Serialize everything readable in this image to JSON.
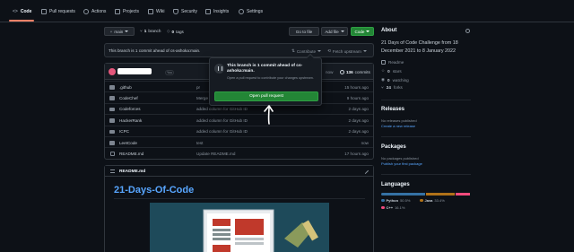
{
  "tabs": [
    {
      "label": "Code",
      "icon": "code-icon",
      "active": true
    },
    {
      "label": "Pull requests",
      "icon": "pull-request-icon"
    },
    {
      "label": "Actions",
      "icon": "play-icon"
    },
    {
      "label": "Projects",
      "icon": "table-icon"
    },
    {
      "label": "Wiki",
      "icon": "book-icon"
    },
    {
      "label": "Security",
      "icon": "shield-icon"
    },
    {
      "label": "Insights",
      "icon": "graph-icon"
    },
    {
      "label": "Settings",
      "icon": "gear-icon"
    }
  ],
  "controls": {
    "branch": "main",
    "branch_count": "1",
    "branch_label": "branch",
    "tag_count": "0",
    "tag_label": "tags",
    "go_to_file": "Go to file",
    "add_file": "Add file",
    "code": "Code"
  },
  "ahead_bar": {
    "text": "This branch is 1 commit ahead of cs-ashoka:main.",
    "contribute": "Contribute",
    "fetch": "Fetch upstream"
  },
  "commit": {
    "you_badge": "You",
    "time": "now",
    "count": "136",
    "count_label": "commits"
  },
  "files": [
    {
      "name": ".github",
      "type": "dir",
      "message": "pr",
      "age": "15 hours ago"
    },
    {
      "name": "CodeChef",
      "type": "dir",
      "message": "Merge",
      "age": "9 hours ago"
    },
    {
      "name": "Codeforces",
      "type": "dir",
      "message": "added column for GitHub ID",
      "age": "2 days ago"
    },
    {
      "name": "HackerRank",
      "type": "dir",
      "message": "added column for GitHub ID",
      "age": "2 days ago"
    },
    {
      "name": "ICPC",
      "type": "dir",
      "message": "added column for GitHub ID",
      "age": "2 days ago"
    },
    {
      "name": "LeetCode",
      "type": "dir",
      "message": "test",
      "age": "now"
    },
    {
      "name": "README.md",
      "type": "file",
      "message": "Update README.md",
      "age": "17 hours ago"
    }
  ],
  "readme": {
    "label": "README.md",
    "title": "21-Days-Of-Code"
  },
  "popup": {
    "title": "This branch is 1 commit ahead of cs-ashoka:main.",
    "subtitle": "Open a pull request to contribute your changes upstream.",
    "button": "Open pull request"
  },
  "about": {
    "heading": "About",
    "description": "21 Days of Code Challenge from 18 December 2021 to 8 January 2022",
    "readme_link": "Readme",
    "stars_count": "0",
    "stars_label": "stars",
    "watching_count": "0",
    "watching_label": "watching",
    "forks_count": "24",
    "forks_label": "forks"
  },
  "releases": {
    "heading": "Releases",
    "empty": "No releases published",
    "link": "Create a new release"
  },
  "packages": {
    "heading": "Packages",
    "empty": "No packages published",
    "link": "Publish your first package"
  },
  "languages": {
    "heading": "Languages",
    "items": [
      {
        "name": "Python",
        "percent": "50.5%",
        "color": "#3572A5",
        "value": 50.5
      },
      {
        "name": "Java",
        "percent": "33.4%",
        "color": "#b07219",
        "value": 33.4
      },
      {
        "name": "C++",
        "percent": "16.1%",
        "color": "#f34b7d",
        "value": 16.1
      }
    ]
  },
  "colors": {
    "background": "#0d1117",
    "accent_green": "#238636",
    "link_blue": "#58a6ff",
    "tab_underline": "#f78166"
  }
}
